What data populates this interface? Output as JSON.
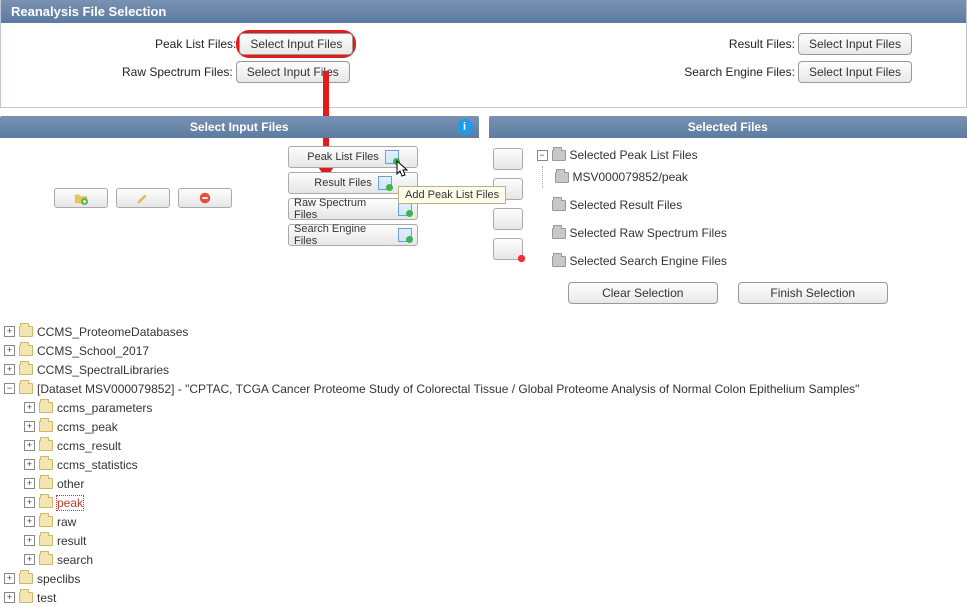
{
  "panel": {
    "title": "Reanalysis File Selection",
    "fields": {
      "peak_list_label": "Peak List Files:",
      "raw_spectrum_label": "Raw Spectrum Files:",
      "result_label": "Result Files:",
      "search_engine_label": "Search Engine Files:",
      "select_btn": "Select Input Files"
    }
  },
  "select_panel": {
    "title": "Select Input Files"
  },
  "selected_panel": {
    "title": "Selected Files"
  },
  "file_type_buttons": {
    "peak_list": "Peak List Files",
    "result": "Result Files",
    "raw_spectrum": "Raw Spectrum Files",
    "search_engine": "Search Engine Files"
  },
  "tooltip": {
    "text": "Add Peak List Files"
  },
  "selected_tree": {
    "peak_root": "Selected Peak List Files",
    "peak_child": "MSV000079852/peak",
    "result_root": "Selected Result Files",
    "raw_root": "Selected Raw Spectrum Files",
    "search_root": "Selected Search Engine Files"
  },
  "actions": {
    "clear": "Clear Selection",
    "finish": "Finish Selection"
  },
  "tree": {
    "n0": "CCMS_ProteomeDatabases",
    "n1": "CCMS_School_2017",
    "n2": "CCMS_SpectralLibraries",
    "n3": "[Dataset MSV000079852] - \"CPTAC, TCGA Cancer Proteome Study of Colorectal Tissue / Global Proteome Analysis of Normal Colon Epithelium Samples\"",
    "n3c0": "ccms_parameters",
    "n3c1": "ccms_peak",
    "n3c2": "ccms_result",
    "n3c3": "ccms_statistics",
    "n3c4": "other",
    "n3c5": "peak",
    "n3c6": "raw",
    "n3c7": "result",
    "n3c8": "search",
    "n4": "speclibs",
    "n5": "test"
  }
}
